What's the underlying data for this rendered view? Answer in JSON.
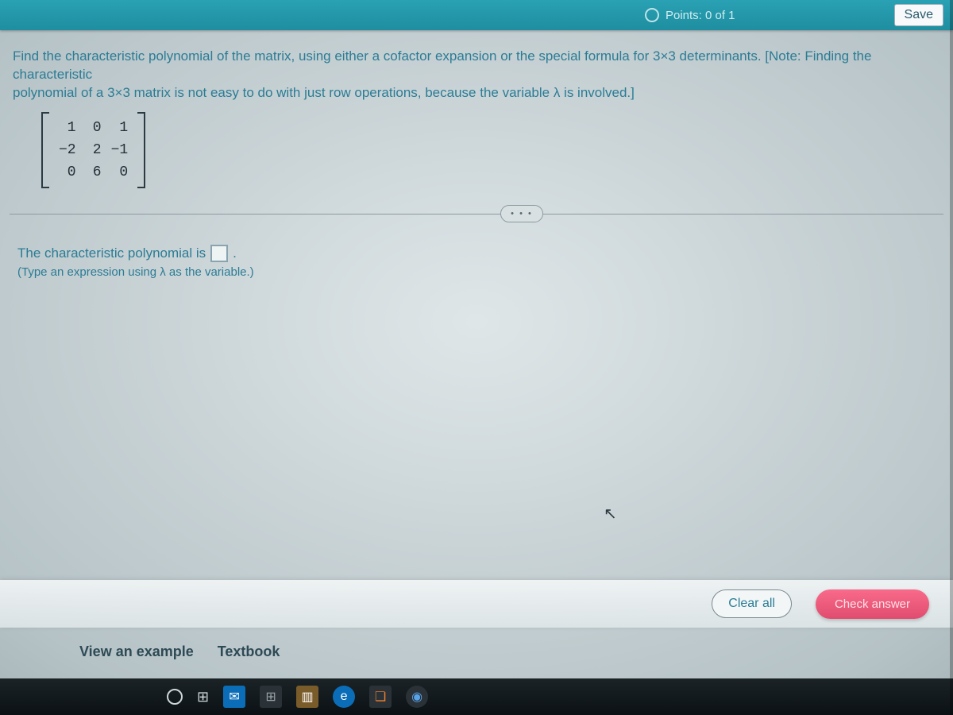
{
  "topbar": {
    "points_label": "Points: 0 of 1",
    "save_label": "Save"
  },
  "question": {
    "text_line1": "Find the characteristic polynomial of the matrix, using either a cofactor expansion or the special formula for 3×3 determinants. [Note: Finding the characteristic",
    "text_line2": "polynomial of a 3×3 matrix is not easy to do with just row operations, because the variable λ is involved.]"
  },
  "matrix": {
    "rows": [
      [
        "1",
        "0",
        "1"
      ],
      [
        "−2",
        "2",
        "−1"
      ],
      [
        "0",
        "6",
        "0"
      ]
    ]
  },
  "divider_glyph": "• • •",
  "answer": {
    "prompt_before": "The characteristic polynomial is",
    "prompt_after": ".",
    "hint": "(Type an expression using λ as the variable.)",
    "value": ""
  },
  "actions": {
    "clear_label": "Clear all",
    "check_label": "Check answer"
  },
  "helpers": {
    "example_label": "View an example",
    "textbook_label": "Textbook"
  },
  "taskbar": {
    "cortana": "cortana",
    "taskview": "⊞",
    "mail": "✉",
    "store": "⊞",
    "files": "▥",
    "edge": "e",
    "office": "❏",
    "google": "◉"
  }
}
